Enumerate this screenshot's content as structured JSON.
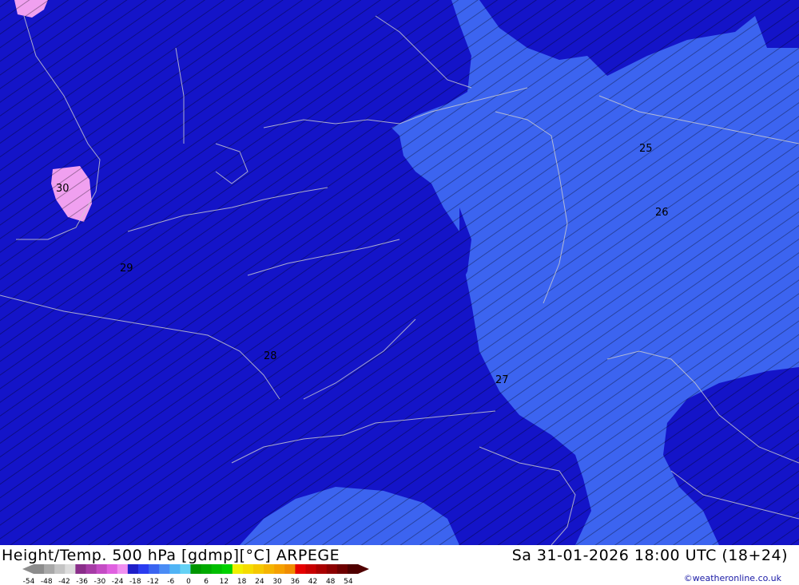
{
  "header": {
    "title": "Height/Temp. 500 hPa [gdmp][°C] ARPEGE",
    "datetime": "Sa 31-01-2026 18:00 UTC (18+24)"
  },
  "legend": {
    "tick_labels": [
      "-54",
      "-48",
      "-42",
      "-36",
      "-30",
      "-24",
      "-18",
      "-12",
      "-6",
      "0",
      "6",
      "12",
      "18",
      "24",
      "30",
      "36",
      "42",
      "48",
      "54"
    ],
    "colors": [
      "#8c8c8c",
      "#a8a8a8",
      "#c4c4c4",
      "#dcdcdc",
      "#8a2e8a",
      "#a63ca6",
      "#c44cc4",
      "#e060e0",
      "#f090f0",
      "#1e1ec8",
      "#2a3cf0",
      "#3a64f0",
      "#4a8cf5",
      "#50b4f5",
      "#64d2f5",
      "#009600",
      "#00aa00",
      "#00be00",
      "#00d200",
      "#f0f000",
      "#f5dc00",
      "#f5c800",
      "#f5b400",
      "#f5a000",
      "#f08c00",
      "#e60000",
      "#c80000",
      "#aa0000",
      "#8c0000",
      "#6e0000",
      "#500000"
    ]
  },
  "credit": "©weatheronline.co.uk",
  "map": {
    "colors": {
      "dark_blue": "#1414c8",
      "mid_blue": "#3c64f0",
      "pink": "#f0a0f0",
      "contour": "#000000",
      "borders": "#c8c8c8"
    },
    "labels": [
      "30",
      "29",
      "28",
      "27",
      "26",
      "25"
    ]
  }
}
